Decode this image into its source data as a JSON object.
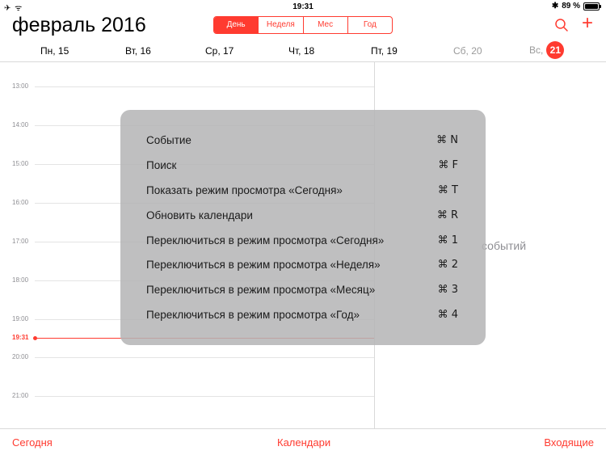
{
  "status": {
    "left_icons": "✈ ᯤ",
    "time": "19:31",
    "bluetooth": "✱",
    "battery": "89 %"
  },
  "header": {
    "month": "февраль 2016",
    "tabs": [
      "День",
      "Неделя",
      "Мес",
      "Год"
    ],
    "active_tab": "День",
    "add": "+"
  },
  "days": [
    {
      "label": "Пн, 15"
    },
    {
      "label": "Вт, 16"
    },
    {
      "label": "Ср, 17"
    },
    {
      "label": "Чт, 18"
    },
    {
      "label": "Пт, 19"
    },
    {
      "label": "Сб, 20"
    },
    {
      "label": "Вс,",
      "badge": "21"
    }
  ],
  "timeline": {
    "hours": [
      "13:00",
      "14:00",
      "15:00",
      "16:00",
      "17:00",
      "18:00",
      "19:00",
      "20:00",
      "21:00"
    ],
    "now": "19:31"
  },
  "side": {
    "no_events": "событий"
  },
  "shortcuts": [
    {
      "label": "Событие",
      "key": "⌘ N"
    },
    {
      "label": "Поиск",
      "key": "⌘ F"
    },
    {
      "label": "Показать режим просмотра «Сегодня»",
      "key": "⌘ T"
    },
    {
      "label": "Обновить календари",
      "key": "⌘ R"
    },
    {
      "label": "Переключиться в режим просмотра «Сегодня»",
      "key": "⌘ 1"
    },
    {
      "label": "Переключиться в режим просмотра «Неделя»",
      "key": "⌘ 2"
    },
    {
      "label": "Переключиться в режим просмотра «Месяц»",
      "key": "⌘ 3"
    },
    {
      "label": "Переключиться в режим просмотра «Год»",
      "key": "⌘ 4"
    }
  ],
  "bottom": {
    "today": "Сегодня",
    "calendars": "Календари",
    "inbox": "Входящие"
  },
  "colors": {
    "accent": "#ff3b30",
    "overlay": "#b4b4b6"
  }
}
